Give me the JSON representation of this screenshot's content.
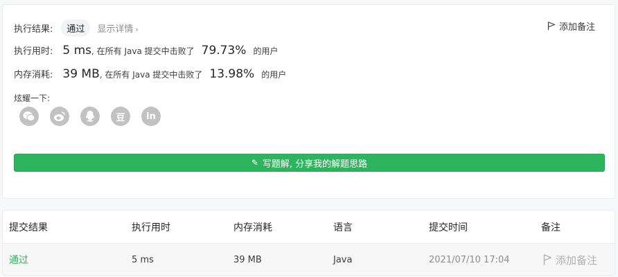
{
  "result": {
    "label": "执行结果:",
    "status": "通过",
    "details_link": "显示详情",
    "add_note": "添加备注"
  },
  "runtime": {
    "label": "执行用时:",
    "value": "5 ms",
    "prefix": ", 在所有 Java 提交中击败了",
    "percent": "79.73%",
    "suffix": "的用户"
  },
  "memory": {
    "label": "内存消耗:",
    "value": "39 MB",
    "prefix": ", 在所有 Java 提交中击败了",
    "percent": "13.98%",
    "suffix": "的用户"
  },
  "share": {
    "label": "炫耀一下:",
    "icons": [
      "wechat-icon",
      "weibo-icon",
      "qq-icon",
      "douban-icon",
      "linkedin-icon"
    ],
    "douban_glyph": "豆",
    "linkedin_glyph": "in"
  },
  "write_solution": "写题解, 分享我的解题思路",
  "table": {
    "headers": [
      "提交结果",
      "执行用时",
      "内存消耗",
      "语言",
      "提交时间",
      "备注"
    ],
    "rows": [
      {
        "status": "通过",
        "runtime": "5 ms",
        "memory": "39 MB",
        "language": "Java",
        "submit_time": "2021/07/10 17:04",
        "note": "添加备注"
      }
    ]
  },
  "colors": {
    "accent_green": "#2db55d",
    "icon_gray": "#c2c2c2"
  }
}
